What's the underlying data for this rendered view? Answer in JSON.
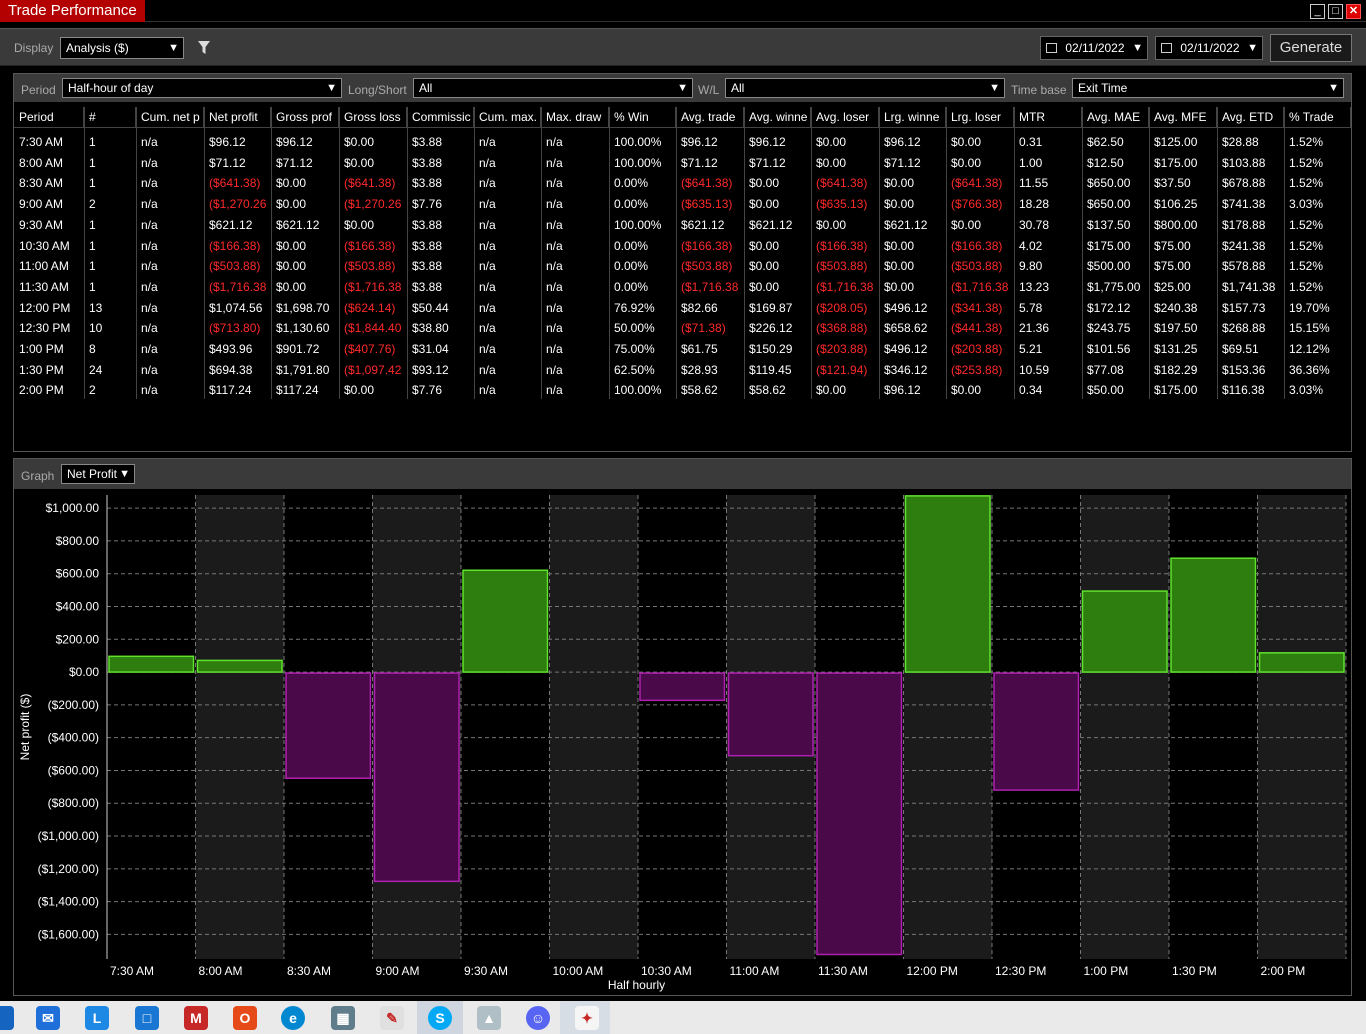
{
  "window": {
    "title": "Trade Performance"
  },
  "toolbar": {
    "display_label": "Display",
    "display_value": "Analysis ($)",
    "date_from": "02/11/2022",
    "date_to": "02/11/2022",
    "generate_label": "Generate"
  },
  "filters": {
    "period_label": "Period",
    "period_value": "Half-hour of day",
    "longshort_label": "Long/Short",
    "longshort_value": "All",
    "wl_label": "W/L",
    "wl_value": "All",
    "timebase_label": "Time base",
    "timebase_value": "Exit Time"
  },
  "table": {
    "columns": [
      "Period",
      "#",
      "Cum. net p",
      "Net profit",
      "Gross prof",
      "Gross loss",
      "Commissic",
      "Cum. max.",
      "Max. draw",
      "% Win",
      "Avg. trade",
      "Avg. winne",
      "Avg. loser",
      "Lrg. winne",
      "Lrg. loser",
      "MTR",
      "Avg. MAE",
      "Avg. MFE",
      "Avg. ETD",
      "% Trade"
    ],
    "rows": [
      [
        "7:30 AM",
        "1",
        "n/a",
        "$96.12",
        "$96.12",
        "$0.00",
        "$3.88",
        "n/a",
        "n/a",
        "100.00%",
        "$96.12",
        "$96.12",
        "$0.00",
        "$96.12",
        "$0.00",
        "0.31",
        "$62.50",
        "$125.00",
        "$28.88",
        "1.52%"
      ],
      [
        "8:00 AM",
        "1",
        "n/a",
        "$71.12",
        "$71.12",
        "$0.00",
        "$3.88",
        "n/a",
        "n/a",
        "100.00%",
        "$71.12",
        "$71.12",
        "$0.00",
        "$71.12",
        "$0.00",
        "1.00",
        "$12.50",
        "$175.00",
        "$103.88",
        "1.52%"
      ],
      [
        "8:30 AM",
        "1",
        "n/a",
        "($641.38)",
        "$0.00",
        "($641.38)",
        "$3.88",
        "n/a",
        "n/a",
        "0.00%",
        "($641.38)",
        "$0.00",
        "($641.38)",
        "$0.00",
        "($641.38)",
        "11.55",
        "$650.00",
        "$37.50",
        "$678.88",
        "1.52%"
      ],
      [
        "9:00 AM",
        "2",
        "n/a",
        "($1,270.26",
        "$0.00",
        "($1,270.26",
        "$7.76",
        "n/a",
        "n/a",
        "0.00%",
        "($635.13)",
        "$0.00",
        "($635.13)",
        "$0.00",
        "($766.38)",
        "18.28",
        "$650.00",
        "$106.25",
        "$741.38",
        "3.03%"
      ],
      [
        "9:30 AM",
        "1",
        "n/a",
        "$621.12",
        "$621.12",
        "$0.00",
        "$3.88",
        "n/a",
        "n/a",
        "100.00%",
        "$621.12",
        "$621.12",
        "$0.00",
        "$621.12",
        "$0.00",
        "30.78",
        "$137.50",
        "$800.00",
        "$178.88",
        "1.52%"
      ],
      [
        "10:30 AM",
        "1",
        "n/a",
        "($166.38)",
        "$0.00",
        "($166.38)",
        "$3.88",
        "n/a",
        "n/a",
        "0.00%",
        "($166.38)",
        "$0.00",
        "($166.38)",
        "$0.00",
        "($166.38)",
        "4.02",
        "$175.00",
        "$75.00",
        "$241.38",
        "1.52%"
      ],
      [
        "11:00 AM",
        "1",
        "n/a",
        "($503.88)",
        "$0.00",
        "($503.88)",
        "$3.88",
        "n/a",
        "n/a",
        "0.00%",
        "($503.88)",
        "$0.00",
        "($503.88)",
        "$0.00",
        "($503.88)",
        "9.80",
        "$500.00",
        "$75.00",
        "$578.88",
        "1.52%"
      ],
      [
        "11:30 AM",
        "1",
        "n/a",
        "($1,716.38",
        "$0.00",
        "($1,716.38",
        "$3.88",
        "n/a",
        "n/a",
        "0.00%",
        "($1,716.38",
        "$0.00",
        "($1,716.38",
        "$0.00",
        "($1,716.38",
        "13.23",
        "$1,775.00",
        "$25.00",
        "$1,741.38",
        "1.52%"
      ],
      [
        "12:00 PM",
        "13",
        "n/a",
        "$1,074.56",
        "$1,698.70",
        "($624.14)",
        "$50.44",
        "n/a",
        "n/a",
        "76.92%",
        "$82.66",
        "$169.87",
        "($208.05)",
        "$496.12",
        "($341.38)",
        "5.78",
        "$172.12",
        "$240.38",
        "$157.73",
        "19.70%"
      ],
      [
        "12:30 PM",
        "10",
        "n/a",
        "($713.80)",
        "$1,130.60",
        "($1,844.40",
        "$38.80",
        "n/a",
        "n/a",
        "50.00%",
        "($71.38)",
        "$226.12",
        "($368.88)",
        "$658.62",
        "($441.38)",
        "21.36",
        "$243.75",
        "$197.50",
        "$268.88",
        "15.15%"
      ],
      [
        "1:00 PM",
        "8",
        "n/a",
        "$493.96",
        "$901.72",
        "($407.76)",
        "$31.04",
        "n/a",
        "n/a",
        "75.00%",
        "$61.75",
        "$150.29",
        "($203.88)",
        "$496.12",
        "($203.88)",
        "5.21",
        "$101.56",
        "$131.25",
        "$69.51",
        "12.12%"
      ],
      [
        "1:30 PM",
        "24",
        "n/a",
        "$694.38",
        "$1,791.80",
        "($1,097.42",
        "$93.12",
        "n/a",
        "n/a",
        "62.50%",
        "$28.93",
        "$119.45",
        "($121.94)",
        "$346.12",
        "($253.88)",
        "10.59",
        "$77.08",
        "$182.29",
        "$153.36",
        "36.36%"
      ],
      [
        "2:00 PM",
        "2",
        "n/a",
        "$117.24",
        "$117.24",
        "$0.00",
        "$7.76",
        "n/a",
        "n/a",
        "100.00%",
        "$58.62",
        "$58.62",
        "$0.00",
        "$96.12",
        "$0.00",
        "0.34",
        "$50.00",
        "$175.00",
        "$116.38",
        "3.03%"
      ]
    ]
  },
  "graph": {
    "label": "Graph",
    "metric": "Net Profit"
  },
  "chart_data": {
    "type": "bar",
    "ylabel": "Net profit ($)",
    "xlabel": "Half hourly",
    "categories": [
      "7:30 AM",
      "8:00 AM",
      "8:30 AM",
      "9:00 AM",
      "9:30 AM",
      "10:00 AM",
      "10:30 AM",
      "11:00 AM",
      "11:30 AM",
      "12:00 PM",
      "12:30 PM",
      "1:00 PM",
      "1:30 PM",
      "2:00 PM"
    ],
    "values": [
      96.12,
      71.12,
      -641.38,
      -1270.26,
      621.12,
      0,
      -166.38,
      -503.88,
      -1716.38,
      1074.56,
      -713.8,
      493.96,
      694.38,
      117.24
    ],
    "yticks": [
      1000,
      800,
      600,
      400,
      200,
      0,
      -200,
      -400,
      -600,
      -800,
      -1000,
      -1200,
      -1400,
      -1600
    ],
    "ytick_labels": [
      "$1,000.00",
      "$800.00",
      "$600.00",
      "$400.00",
      "$200.00",
      "$0.00",
      "($200.00)",
      "($400.00)",
      "($600.00)",
      "($800.00)",
      "($1,000.00)",
      "($1,200.00)",
      "($1,400.00)",
      "($1,600.00)"
    ],
    "ylim": [
      -1750,
      1080
    ],
    "grid": true,
    "colors": {
      "positive": "#2e7d0f",
      "positive_edge": "#5fe32b",
      "negative": "#4a0a4a",
      "negative_edge": "#b020b0",
      "band": "#1b1b1b"
    }
  },
  "taskbar": {
    "icons": [
      "start-icon",
      "mail-icon",
      "l-app-icon",
      "outlook-icon",
      "mcafee-icon",
      "office-icon",
      "edge-icon",
      "calculator-icon",
      "paint-icon",
      "skype-icon",
      "photos-icon",
      "discord-icon",
      "trading-app-icon"
    ]
  }
}
